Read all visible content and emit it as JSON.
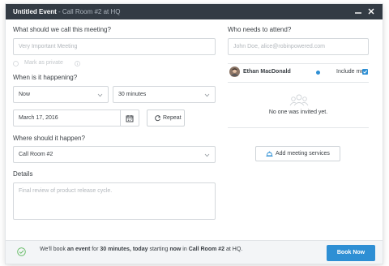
{
  "titlebar": {
    "title": "Untitled Event",
    "subtitle": " - Call Room #2 at HQ"
  },
  "form": {
    "name_label": "What should we call this meeting?",
    "name_placeholder": "Very Important Meeting",
    "private_label": "Mark as private",
    "when_label": "When is it happening?",
    "start_value": "Now",
    "duration_value": "30 minutes",
    "date_value": "March 17, 2016",
    "repeat_label": "Repeat",
    "where_label": "Where should it happen?",
    "room_value": "Call Room #2",
    "details_label": "Details",
    "details_placeholder": "Final review of product release cycle."
  },
  "attendees": {
    "label": "Who needs to attend?",
    "placeholder": "John Doe, alice@robinpowered.com",
    "organizer_name": "Ethan MacDonald",
    "include_me_label": "Include me",
    "include_me_checked": true,
    "empty_text": "No one was invited yet.",
    "add_services_label": "Add meeting services"
  },
  "footer": {
    "pre": "We'll book ",
    "b1": "an event",
    "m1": " for ",
    "b2": "30 minutes, today",
    "m2": " starting ",
    "b3": "now",
    "m3": " in ",
    "b4": "Call Room #2",
    "post": " at HQ.",
    "book_label": "Book Now"
  },
  "colors": {
    "titlebar": "#333b44",
    "accent": "#2e8fd4",
    "success": "#5cb85c"
  }
}
